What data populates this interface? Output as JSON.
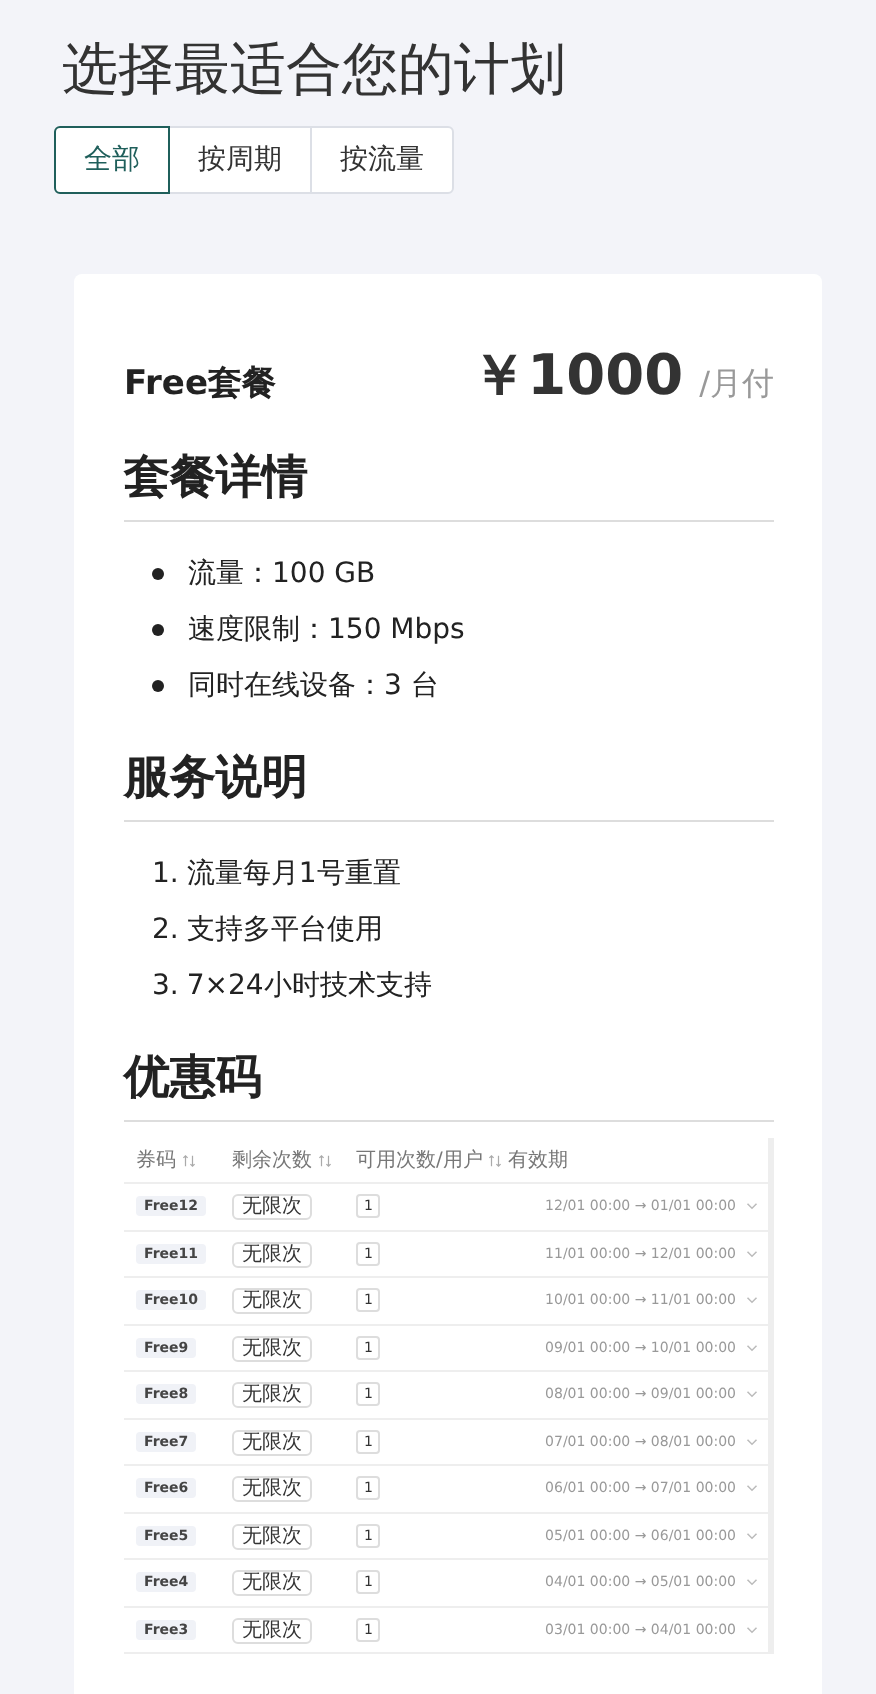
{
  "title": "选择最适合您的计划",
  "tabs": [
    {
      "label": "全部",
      "selected": true
    },
    {
      "label": "按周期",
      "selected": false
    },
    {
      "label": "按流量",
      "selected": false
    }
  ],
  "plan": {
    "name": "Free套餐",
    "price": "￥1000",
    "period": "/月付"
  },
  "details": {
    "heading": "套餐详情",
    "items": [
      "流量：100 GB",
      "速度限制：150 Mbps",
      "同时在线设备：3 台"
    ]
  },
  "service": {
    "heading": "服务说明",
    "items": [
      {
        "number": "1.",
        "text": "流量每月1号重置"
      },
      {
        "number": "2.",
        "text": "支持多平台使用"
      },
      {
        "number": "3.",
        "text": "7×24小时技术支持"
      }
    ]
  },
  "coupons": {
    "heading": "优惠码",
    "columns": [
      {
        "label": "券码",
        "kind": "sortable"
      },
      {
        "label": "剩余次数",
        "kind": "sortable"
      },
      {
        "label": "可用次数/用户",
        "kind": "sortable"
      },
      {
        "label": "有效期",
        "kind": "plain"
      }
    ],
    "rows": [
      {
        "code": "Free12",
        "remaining": "无限次",
        "per_user": "1",
        "validity": "12/01 00:00 → 01/01 00:00"
      },
      {
        "code": "Free11",
        "remaining": "无限次",
        "per_user": "1",
        "validity": "11/01 00:00 → 12/01 00:00"
      },
      {
        "code": "Free10",
        "remaining": "无限次",
        "per_user": "1",
        "validity": "10/01 00:00 → 11/01 00:00"
      },
      {
        "code": "Free9",
        "remaining": "无限次",
        "per_user": "1",
        "validity": "09/01 00:00 → 10/01 00:00"
      },
      {
        "code": "Free8",
        "remaining": "无限次",
        "per_user": "1",
        "validity": "08/01 00:00 → 09/01 00:00"
      },
      {
        "code": "Free7",
        "remaining": "无限次",
        "per_user": "1",
        "validity": "07/01 00:00 → 08/01 00:00"
      },
      {
        "code": "Free6",
        "remaining": "无限次",
        "per_user": "1",
        "validity": "06/01 00:00 → 07/01 00:00"
      },
      {
        "code": "Free5",
        "remaining": "无限次",
        "per_user": "1",
        "validity": "05/01 00:00 → 06/01 00:00"
      },
      {
        "code": "Free4",
        "remaining": "无限次",
        "per_user": "1",
        "validity": "04/01 00:00 → 05/01 00:00"
      },
      {
        "code": "Free3",
        "remaining": "无限次",
        "per_user": "1",
        "validity": "03/01 00:00 → 04/01 00:00"
      }
    ]
  }
}
